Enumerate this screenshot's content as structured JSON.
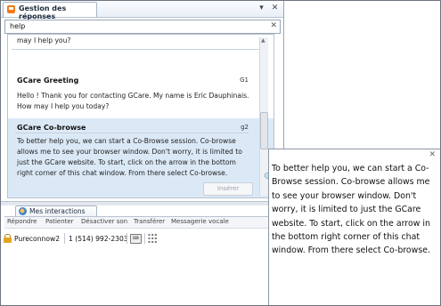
{
  "window": {
    "title": "Gestion des réponses",
    "pin_glyph": "▾",
    "close_glyph": "✕"
  },
  "search": {
    "value": "help",
    "clear_glyph": "✕"
  },
  "responses": [
    {
      "title": "",
      "code": "",
      "body": "may I help you?"
    },
    {
      "title": "GCare Greeting",
      "code": "G1",
      "body": "Hello ! Thank you for contacting GCare. My name is Eric Dauphinais. How may I help you today?"
    },
    {
      "title": "GCare Co-browse",
      "code": "g2",
      "body": "To better help you, we can start a Co-Browse session.  Co-browse allows me to see your browser window.  Don't worry, it is limited to just the GCare website.  To start, click on the arrow in the bottom right corner of this chat window.  From there select Co-browse."
    }
  ],
  "insert_button": "Insérer",
  "interactions": {
    "tab_label": "Mes interactions",
    "toolbar": [
      "Répondre",
      "Patienter",
      "Désactiver son",
      "Transférer",
      "Messagerie vocale"
    ],
    "call": {
      "name": "Pureconnow2",
      "phone": "1 (514) 992-2303"
    }
  },
  "popup": {
    "close_glyph": "✕",
    "text": "To better help you, we can start a Co-Browse session.  Co-browse allows me to see your browser window.  Don't worry, it is limited to just the GCare website.  To start, click on the arrow in the bottom right corner of this chat window.  From there select Co-browse."
  },
  "colors": {
    "app_icon": "#f07a1c",
    "selected_row": "#dbe9f7",
    "lock": "#e3a324"
  }
}
